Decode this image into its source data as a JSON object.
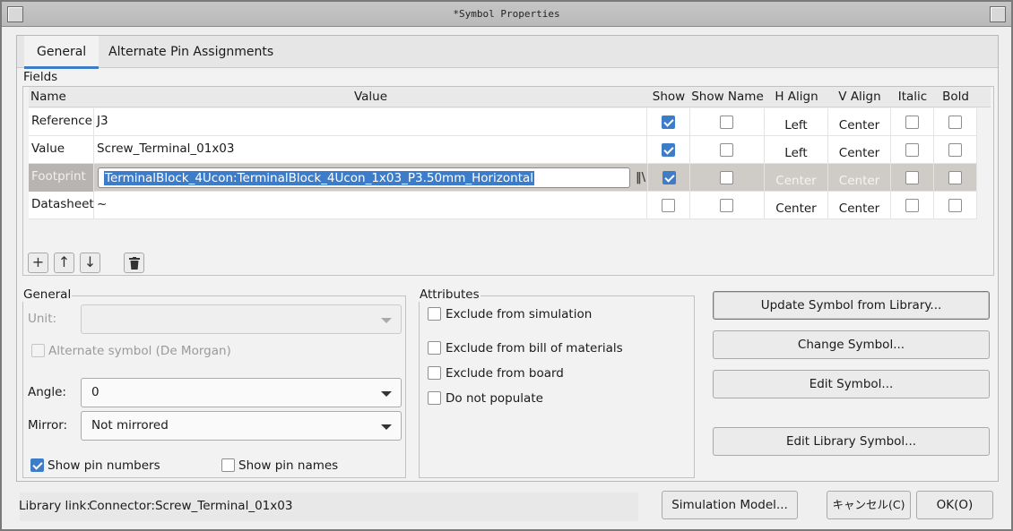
{
  "window": {
    "title": "*Symbol Properties"
  },
  "tabs": [
    {
      "label": "General",
      "active": true
    },
    {
      "label": "Alternate Pin Assignments",
      "active": false
    }
  ],
  "fields": {
    "group_label": "Fields",
    "columns": [
      "Name",
      "Value",
      "Show",
      "Show Name",
      "H Align",
      "V Align",
      "Italic",
      "Bold"
    ],
    "rows": [
      {
        "name": "Reference",
        "value": "J3",
        "show": true,
        "show_name": false,
        "h_align": "Left",
        "v_align": "Center",
        "italic": false,
        "bold": false
      },
      {
        "name": "Value",
        "value": "Screw_Terminal_01x03",
        "show": true,
        "show_name": false,
        "h_align": "Left",
        "v_align": "Center",
        "italic": false,
        "bold": false
      },
      {
        "name": "Footprint",
        "value": "TerminalBlock_4Ucon:TerminalBlock_4Ucon_1x03_P3.50mm_Horizontal",
        "show": true,
        "show_name": false,
        "h_align": "Center",
        "v_align": "Center",
        "italic": false,
        "bold": false,
        "selected": true,
        "editing": true
      },
      {
        "name": "Datasheet",
        "value": "~",
        "show": false,
        "show_name": false,
        "h_align": "Center",
        "v_align": "Center",
        "italic": false,
        "bold": false
      }
    ],
    "library_browse_icon": "library-books-icon",
    "toolbar_icons": [
      "add-icon",
      "arrow-up-icon",
      "arrow-down-icon",
      "trash-icon"
    ]
  },
  "general": {
    "group_label": "General",
    "unit_label": "Unit:",
    "unit_value": "",
    "alternate_symbol_label": "Alternate symbol (De Morgan)",
    "alternate_symbol_checked": false,
    "angle_label": "Angle:",
    "angle_value": "0",
    "mirror_label": "Mirror:",
    "mirror_value": "Not mirrored",
    "show_pin_numbers_label": "Show pin numbers",
    "show_pin_numbers_checked": true,
    "show_pin_names_label": "Show pin names",
    "show_pin_names_checked": false
  },
  "attributes": {
    "group_label": "Attributes",
    "exclude_simulation": "Exclude from simulation",
    "exclude_bom": "Exclude from bill of materials",
    "exclude_board": "Exclude from board",
    "do_not_populate": "Do not populate"
  },
  "actions": {
    "update_symbol": "Update Symbol from Library...",
    "change_symbol": "Change Symbol...",
    "edit_symbol": "Edit Symbol...",
    "edit_library_symbol": "Edit Library Symbol..."
  },
  "footer": {
    "library_link_label": "Library link:",
    "library_link_value": "Connector:Screw_Terminal_01x03",
    "simulation_model": "Simulation Model...",
    "cancel": "キャンセル(C)",
    "ok": "OK(O)"
  },
  "colors": {
    "accent": "#3d7cc9",
    "selected_row": "#cfcbc7"
  }
}
